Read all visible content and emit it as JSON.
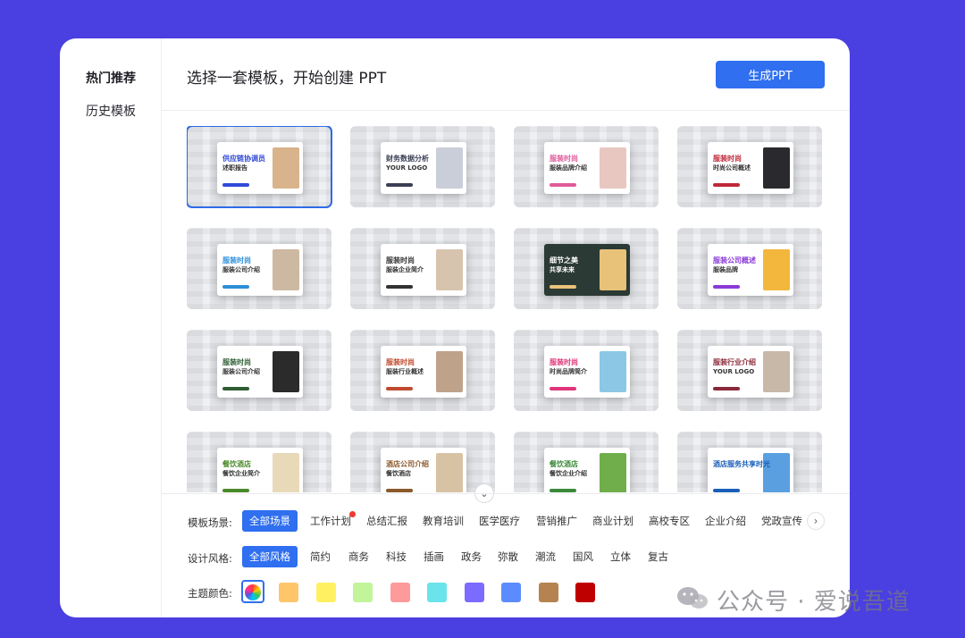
{
  "sidebar": {
    "items": [
      {
        "label": "热门推荐",
        "active": true
      },
      {
        "label": "历史模板",
        "active": false
      }
    ]
  },
  "header": {
    "title": "选择一套模板，开始创建 PPT",
    "generate_label": "生成PPT"
  },
  "templates": [
    {
      "t1": "供应链协调员",
      "t2": "述职报告",
      "accent": "#2f49d8",
      "photo": "#d9b38c",
      "selected": true
    },
    {
      "t1": "财务数据分析",
      "t2": "YOUR LOGO",
      "accent": "#3a3f55",
      "photo": "#c9ced8",
      "selected": false
    },
    {
      "t1": "服装时尚",
      "t2": "服装品牌介绍",
      "accent": "#e05a9a",
      "photo": "#e8c7c0",
      "selected": false
    },
    {
      "t1": "服装时尚",
      "t2": "时尚公司概述",
      "accent": "#c0283a",
      "photo": "#2a2a2e",
      "selected": false
    },
    {
      "t1": "服装时尚",
      "t2": "服装公司介绍",
      "accent": "#2f8fd8",
      "photo": "#cdb8a2",
      "selected": false
    },
    {
      "t1": "服装时尚",
      "t2": "服装企业简介",
      "accent": "#333333",
      "photo": "#d7c3ae",
      "selected": false
    },
    {
      "t1": "细节之美",
      "t2": "共享未来",
      "accent": "#ffffff",
      "photo": "#e9c27a",
      "selected": false
    },
    {
      "t1": "服装公司概述",
      "t2": "服装品牌",
      "accent": "#8a3ad8",
      "photo": "#f2b73c",
      "selected": false
    },
    {
      "t1": "服装时尚",
      "t2": "服装公司介绍",
      "accent": "#2f5d34",
      "photo": "#2b2b2b",
      "selected": false
    },
    {
      "t1": "服装时尚",
      "t2": "服装行业概述",
      "accent": "#c04a2f",
      "photo": "#bfa28a",
      "selected": false
    },
    {
      "t1": "服装时尚",
      "t2": "时尚品牌简介",
      "accent": "#e0357a",
      "photo": "#8cc7e6",
      "selected": false
    },
    {
      "t1": "服装行业介绍",
      "t2": "YOUR LOGO",
      "accent": "#8a2a3a",
      "photo": "#c8b8a8",
      "selected": false
    },
    {
      "t1": "餐饮酒店",
      "t2": "餐饮企业简介",
      "accent": "#4a8a2a",
      "photo": "#e8d9b8",
      "selected": false
    },
    {
      "t1": "酒店公司介绍",
      "t2": "餐饮酒店",
      "accent": "#8a5a2a",
      "photo": "#d8c2a4",
      "selected": false
    },
    {
      "t1": "餐饮酒店",
      "t2": "餐饮企业介绍",
      "accent": "#3a8a3a",
      "photo": "#6fae4a",
      "selected": false
    },
    {
      "t1": "酒店服务共享时光",
      "t2": "",
      "accent": "#1a5fb8",
      "photo": "#5aa0e0",
      "selected": false
    }
  ],
  "filters": {
    "scene_label": "模板场景:",
    "scenes": [
      "全部场景",
      "工作计划",
      "总结汇报",
      "教育培训",
      "医学医疗",
      "营销推广",
      "商业计划",
      "高校专区",
      "企业介绍",
      "党政宣传"
    ],
    "style_label": "设计风格:",
    "styles": [
      "全部风格",
      "简约",
      "商务",
      "科技",
      "插画",
      "政务",
      "弥散",
      "潮流",
      "国风",
      "立体",
      "复古"
    ],
    "color_label": "主题颜色:",
    "colors": [
      "#ffc56b",
      "#fff062",
      "#c2f49a",
      "#ff9a9a",
      "#6ae3ea",
      "#7b6bff",
      "#5b8cff",
      "#b5834f",
      "#c00000"
    ]
  },
  "watermark": {
    "text": "公众号 · 爱说吾道"
  }
}
